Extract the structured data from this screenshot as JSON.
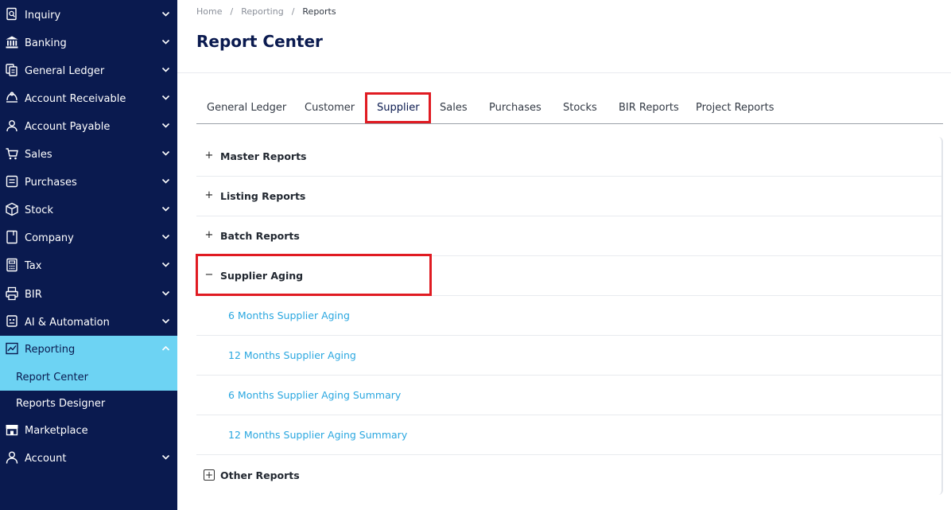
{
  "sidebar": {
    "items": [
      {
        "label": "Inquiry",
        "icon": "search-document-icon"
      },
      {
        "label": "Banking",
        "icon": "bank-icon"
      },
      {
        "label": "General Ledger",
        "icon": "ledger-icon"
      },
      {
        "label": "Account Receivable",
        "icon": "receivable-icon"
      },
      {
        "label": "Account Payable",
        "icon": "payable-icon"
      },
      {
        "label": "Sales",
        "icon": "cart-icon"
      },
      {
        "label": "Purchases",
        "icon": "purchase-icon"
      },
      {
        "label": "Stock",
        "icon": "box-icon"
      },
      {
        "label": "Company",
        "icon": "company-icon"
      },
      {
        "label": "Tax",
        "icon": "tax-icon"
      },
      {
        "label": "BIR",
        "icon": "bir-icon"
      },
      {
        "label": "AI & Automation",
        "icon": "robot-icon"
      },
      {
        "label": "Reporting",
        "icon": "chart-icon"
      }
    ],
    "reporting_sub": [
      {
        "label": "Report Center"
      },
      {
        "label": "Reports Designer"
      }
    ],
    "bottom_items": [
      {
        "label": "Marketplace",
        "icon": "store-icon"
      },
      {
        "label": "Account",
        "icon": "user-icon"
      }
    ]
  },
  "breadcrumb": {
    "home": "Home",
    "reporting": "Reporting",
    "reports": "Reports",
    "separator": "/"
  },
  "page": {
    "title": "Report Center"
  },
  "tabs": [
    {
      "label": "General Ledger"
    },
    {
      "label": "Customer"
    },
    {
      "label": "Supplier"
    },
    {
      "label": "Sales"
    },
    {
      "label": "Purchases"
    },
    {
      "label": "Stocks"
    },
    {
      "label": "BIR Reports"
    },
    {
      "label": "Project Reports"
    }
  ],
  "active_tab": "Supplier",
  "sections": [
    {
      "title": "Master Reports",
      "toggle": "+"
    },
    {
      "title": "Listing Reports",
      "toggle": "+"
    },
    {
      "title": "Batch Reports",
      "toggle": "+"
    },
    {
      "title": "Supplier Aging",
      "toggle": "−"
    }
  ],
  "aging_reports": [
    {
      "label": "6 Months Supplier Aging"
    },
    {
      "label": "12 Months Supplier Aging"
    },
    {
      "label": "6 Months Supplier Aging Summary"
    },
    {
      "label": "12 Months Supplier Aging Summary"
    }
  ],
  "other_section": {
    "title": "Other Reports",
    "toggle": "+"
  },
  "colors": {
    "sidebar_bg": "#0a1a4f",
    "active_bg": "#6dd3f3",
    "link": "#2aa7e0",
    "highlight": "#e01b22"
  }
}
